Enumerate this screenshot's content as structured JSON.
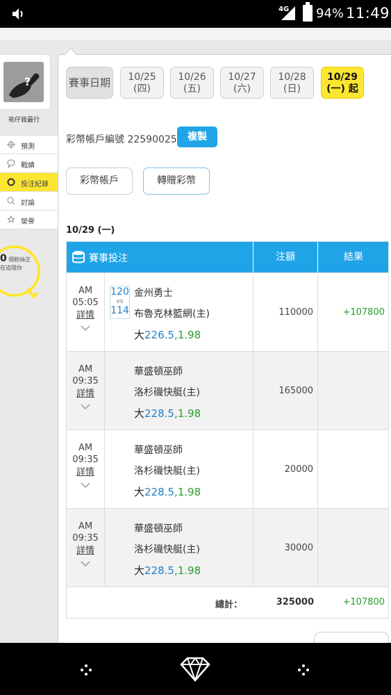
{
  "status_bar": {
    "network": "4G",
    "battery": "94%",
    "time": "11:49"
  },
  "sidebar": {
    "username": "祐仔我最行",
    "menu": [
      {
        "label": "預測",
        "icon": "crosshair-icon"
      },
      {
        "label": "戰績",
        "icon": "chat-icon"
      },
      {
        "label": "投注紀錄",
        "icon": "circle-icon",
        "active": true
      },
      {
        "label": "討論",
        "icon": "search-icon"
      },
      {
        "label": "榮譽",
        "icon": "trophy-icon"
      }
    ],
    "tip": {
      "count": "0",
      "line1": "個粉絲正",
      "line2": "在追隨你"
    }
  },
  "date_tabs": {
    "label": "賽事日期",
    "dates": [
      {
        "d": "10/25",
        "w": "(四)"
      },
      {
        "d": "10/26",
        "w": "(五)"
      },
      {
        "d": "10/27",
        "w": "(六)"
      },
      {
        "d": "10/28",
        "w": "(日)"
      },
      {
        "d": "10/29",
        "w": "(一) 起",
        "active": true
      }
    ]
  },
  "account": {
    "text": "彩幣帳戶編號 22590025",
    "copy_label": "複製"
  },
  "tabs": {
    "wallet": "彩幣帳戶",
    "transfer": "轉贈彩幣"
  },
  "date_heading": "10/29 (一)",
  "table": {
    "headers": {
      "event": "賽事投注",
      "amount": "注額",
      "result": "結果"
    },
    "rows": [
      {
        "ampm": "AM",
        "time": "05:05",
        "detail": "詳情",
        "score_a": "120",
        "vs": "vs",
        "score_b": "114",
        "team1": "金州勇士",
        "team2": "布魯克林籃網(主)",
        "side": "大",
        "points": "226.5",
        "odds": "1.98",
        "amount": "110000",
        "result": "+107800"
      },
      {
        "ampm": "AM",
        "time": "09:35",
        "detail": "詳情",
        "team1": "華盛頓巫師",
        "team2": "洛杉磯快艇(主)",
        "side": "大",
        "points": "228.5",
        "odds": "1.98",
        "amount": "165000",
        "result": ""
      },
      {
        "ampm": "AM",
        "time": "09:35",
        "detail": "詳情",
        "team1": "華盛頓巫師",
        "team2": "洛杉磯快艇(主)",
        "side": "大",
        "points": "228.5",
        "odds": "1.98",
        "amount": "20000",
        "result": ""
      },
      {
        "ampm": "AM",
        "time": "09:35",
        "detail": "詳情",
        "team1": "華盛頓巫師",
        "team2": "洛杉磯快艇(主)",
        "side": "大",
        "points": "228.5",
        "odds": "1.98",
        "amount": "30000",
        "result": ""
      }
    ],
    "total": {
      "label": "總計：",
      "amount": "325000",
      "result": "+107800"
    }
  },
  "colors": {
    "accent": "#1fa4e8",
    "highlight": "#fde632",
    "positive": "#2a9d2a"
  }
}
